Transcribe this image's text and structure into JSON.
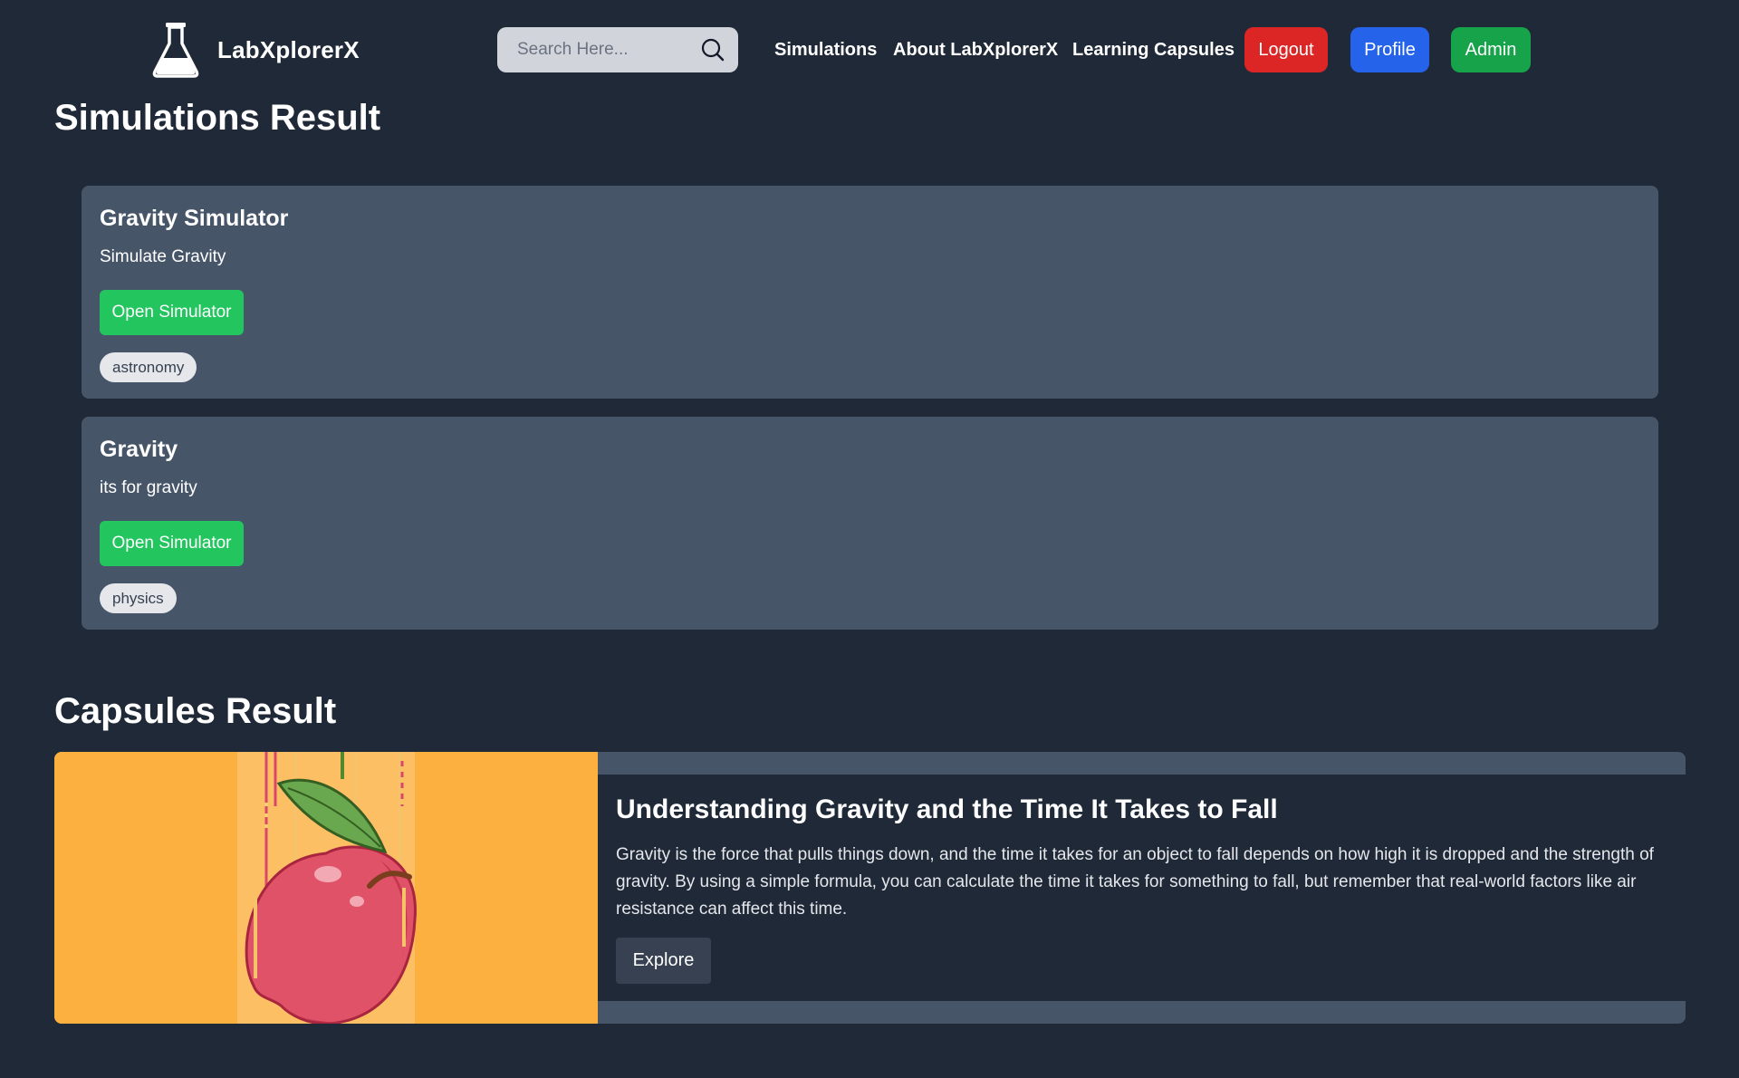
{
  "brand": {
    "name": "LabXplorerX",
    "logo_icon": "flask-icon"
  },
  "search": {
    "placeholder": "Search Here...",
    "value": "",
    "icon": "search-icon"
  },
  "nav": {
    "links": [
      {
        "label": "Simulations"
      },
      {
        "label": "About LabXplorerX"
      },
      {
        "label": "Learning Capsules"
      }
    ],
    "logout_label": "Logout",
    "profile_label": "Profile",
    "admin_label": "Admin"
  },
  "colors": {
    "background": "#1f2937",
    "card": "#475569",
    "logout": "#dc2626",
    "profile": "#2563eb",
    "admin": "#16a34a",
    "open_simulator": "#22c55e",
    "capsule_image_bg": "#fbb040"
  },
  "simulations": {
    "title": "Simulations Result",
    "items": [
      {
        "title": "Gravity Simulator",
        "description": "Simulate Gravity",
        "button_label": "Open Simulator",
        "tag": "astronomy"
      },
      {
        "title": "Gravity",
        "description": "its for gravity",
        "button_label": "Open Simulator",
        "tag": "physics"
      }
    ]
  },
  "capsules": {
    "title": "Capsules Result",
    "items": [
      {
        "title": "Understanding Gravity and the Time It Takes to Fall",
        "description": "Gravity is the force that pulls things down, and the time it takes for an object to fall depends on how high it is dropped and the strength of gravity. By using a simple formula, you can calculate the time it takes for something to fall, but remember that real-world factors like air resistance can affect this time.",
        "button_label": "Explore",
        "image_icon": "falling-apple-illustration"
      }
    ]
  }
}
